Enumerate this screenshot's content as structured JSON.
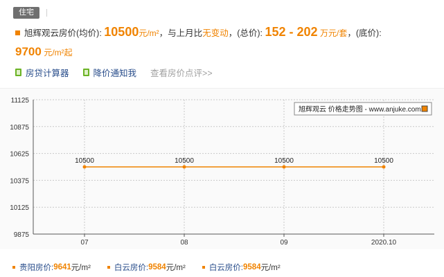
{
  "tag": {
    "label": "住宅"
  },
  "summary": {
    "prefix": "旭辉观云房价(均价): ",
    "avg_price": "10500",
    "avg_unit": "元/m²",
    "compare_text": "，与上月比",
    "compare_value": "无变动",
    "total_label": "，(总价): ",
    "total_range": "152 - 202",
    "total_unit": "万元/套",
    "floor_label": "，(底价):",
    "floor_price": "9700",
    "floor_unit": "元/m²起"
  },
  "links": {
    "loan_calc": "房贷计算器",
    "price_alert": "降价通知我",
    "reviews": "查看房价点评>>"
  },
  "chart_data": {
    "type": "line",
    "title": "旭辉观云 价格走势图 - www.anjuke.com",
    "categories": [
      "07",
      "08",
      "09",
      "2020.10"
    ],
    "series": [
      {
        "name": "旭辉观云 价格走势图 - www.anjuke.com",
        "values": [
          10500,
          10500,
          10500,
          10500
        ]
      }
    ],
    "data_labels": [
      "10500",
      "10500",
      "10500",
      "10500"
    ],
    "yticks": [
      "11125",
      "10875",
      "10625",
      "10375",
      "10125",
      "9875"
    ],
    "ytick_values": [
      11125,
      10875,
      10625,
      10375,
      10125,
      9875
    ],
    "ylim": [
      9875,
      11125
    ],
    "grid": true,
    "legend": "top-right",
    "color": "#f08300"
  },
  "nearby": [
    {
      "label": "贵阳房价:",
      "value": "9641",
      "unit": "元/m²"
    },
    {
      "label": "白云房价:",
      "value": "9584",
      "unit": "元/m²"
    },
    {
      "label": "白云房价:",
      "value": "9584",
      "unit": "元/m²"
    }
  ]
}
